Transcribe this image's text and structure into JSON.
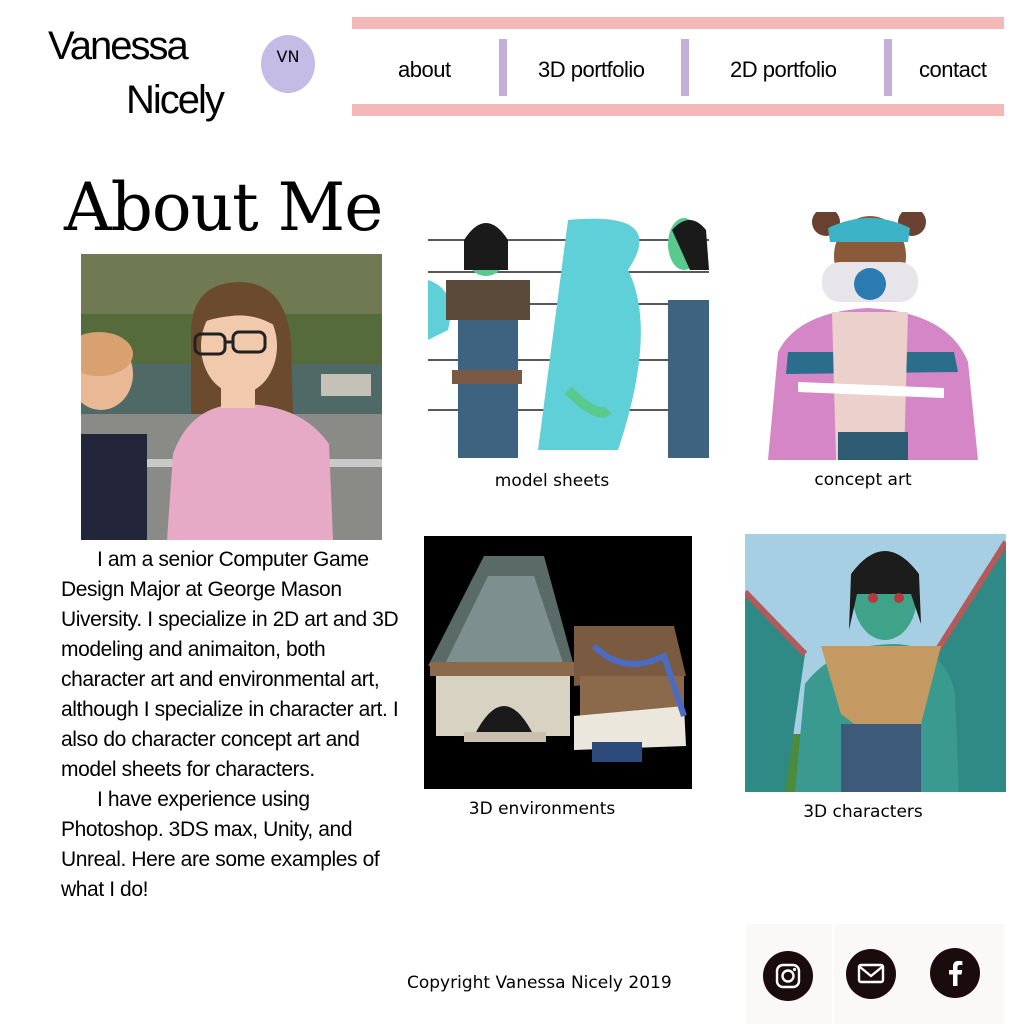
{
  "brand": {
    "first_name": "Vanessa",
    "last_name": "Nicely",
    "initials": "VN",
    "badge_color": "#c5bce6"
  },
  "nav": {
    "items": [
      {
        "label": "about"
      },
      {
        "label": "3D portfolio"
      },
      {
        "label": "2D portfolio"
      },
      {
        "label": "contact"
      }
    ],
    "bar_color": "#f4b8b8",
    "divider_color": "#c2b0d8"
  },
  "about": {
    "title": "About Me",
    "photo_icon": "profile-photo",
    "paragraph_1": "I am a senior Computer Game Design Major at George Mason Uiversity. I specialize in 2D art and 3D modeling and animaiton, both character art and environmental art, although I specialize in character art. I also do character concept art and model sheets for characters.",
    "paragraph_2": "I have experience using Photoshop. 3DS max, Unity, and Unreal. Here are some examples of what I do!"
  },
  "gallery": {
    "items": [
      {
        "caption": "model sheets"
      },
      {
        "caption": "concept art"
      },
      {
        "caption": "3D environments"
      },
      {
        "caption": "3D characters"
      }
    ]
  },
  "footer": {
    "copyright": "Copyright Vanessa Nicely 2019",
    "social": [
      {
        "icon": "instagram-icon"
      },
      {
        "icon": "mail-icon"
      },
      {
        "icon": "facebook-icon"
      }
    ]
  }
}
